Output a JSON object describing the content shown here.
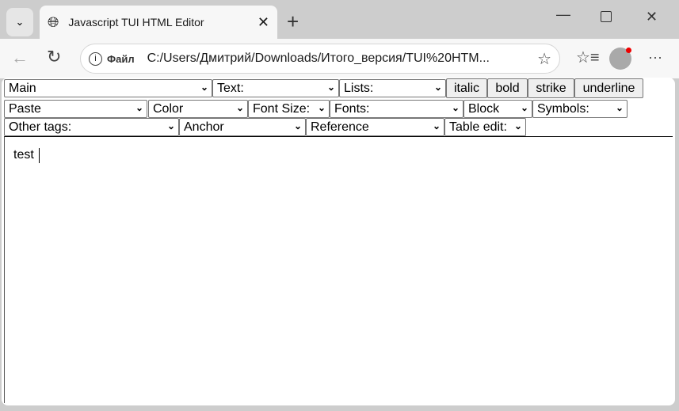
{
  "browser": {
    "tab_title": "Javascript TUI HTML Editor",
    "address_label": "Файл",
    "url": "C:/Users/Дмитрий/Downloads/Итого_версия/TUI%20HTM..."
  },
  "toolbar": {
    "row1": {
      "main": "Main",
      "text": "Text:",
      "lists": "Lists:",
      "italic": "italic",
      "bold": "bold",
      "strike": "strike",
      "underline": "underline"
    },
    "row2": {
      "paste": "Paste",
      "color": "Color",
      "font_size": "Font Size:",
      "fonts": "Fonts:",
      "block": "Block",
      "symbols": "Symbols:"
    },
    "row3": {
      "other_tags": "Other tags:",
      "anchor": "Anchor",
      "reference": "Reference",
      "table_edit": "Table edit:"
    }
  },
  "editor": {
    "content": "test"
  }
}
